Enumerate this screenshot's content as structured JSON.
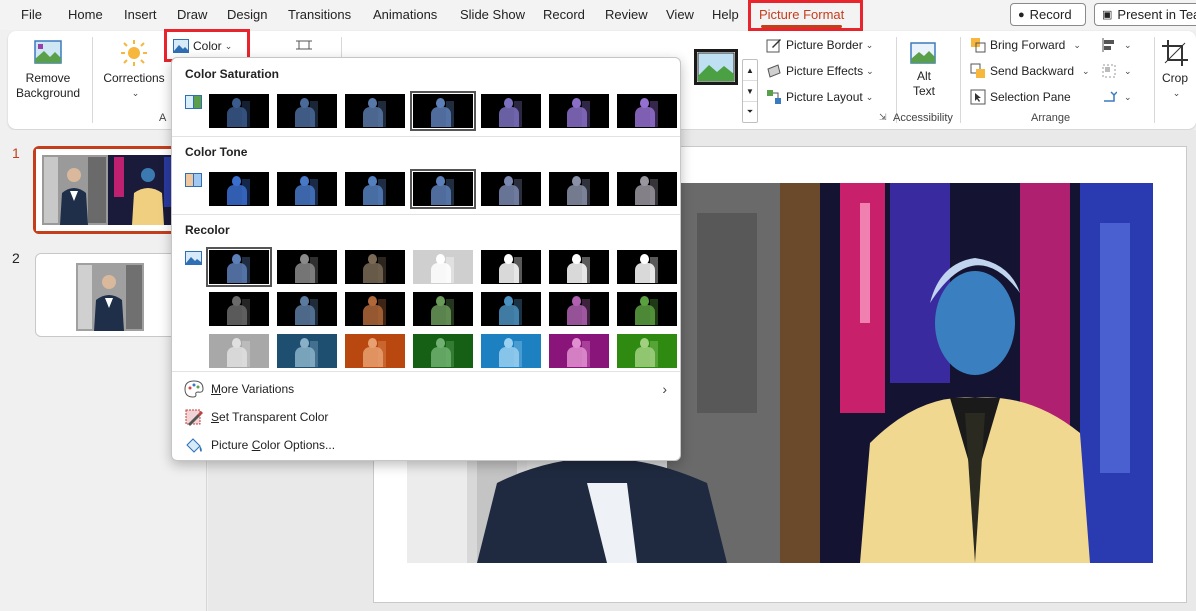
{
  "menu": {
    "tabs": [
      "File",
      "Home",
      "Insert",
      "Draw",
      "Design",
      "Transitions",
      "Animations",
      "Slide Show",
      "Record",
      "Review",
      "View",
      "Help",
      "Picture Format"
    ],
    "active_tab": "Picture Format",
    "record_button": "Record",
    "present_button": "Present in Tea"
  },
  "ribbon": {
    "remove_background": [
      "Remove",
      "Background"
    ],
    "corrections": "Corrections",
    "color": "Color",
    "adjust_group_fragment": "A",
    "picture_border": "Picture Border",
    "picture_effects": "Picture Effects",
    "picture_layout": "Picture Layout",
    "alt_text": [
      "Alt",
      "Text"
    ],
    "accessibility_group": "Accessibility",
    "bring_forward": "Bring Forward",
    "send_backward": "Send Backward",
    "selection_pane": "Selection Pane",
    "arrange_group": "Arrange",
    "crop": "Crop"
  },
  "slides": {
    "numbers": [
      "1",
      "2"
    ]
  },
  "dropdown": {
    "saturation_title": "Color Saturation",
    "tone_title": "Color Tone",
    "recolor_title": "Recolor",
    "more_variations": {
      "prefix": "",
      "accel": "M",
      "rest": "ore Variations"
    },
    "set_transparent": {
      "prefix": "",
      "accel": "S",
      "rest": "et Transparent Color"
    },
    "picture_color_options": {
      "prefix": "Picture ",
      "accel": "C",
      "rest": "olor Options..."
    },
    "saturation_colors": [
      "#3a5b8c",
      "#4a6a9a",
      "#5878a8",
      "#5d7fb8",
      "#7b70c0",
      "#8a6ec8",
      "#9470d0"
    ],
    "tone_colors": [
      "#3a6fd0",
      "#4878c8",
      "#5580c0",
      "#5d7fb8",
      "#7a88b0",
      "#8a90a8",
      "#9a96a0"
    ],
    "recolor_rows": [
      [
        {
          "bg": "#000000",
          "fig": "#5d7fb8"
        },
        {
          "bg": "#000000",
          "fig": "#8a8a8a"
        },
        {
          "bg": "#000000",
          "fig": "#7a6a55"
        },
        {
          "bg": "#cfcfcf",
          "fig": "#ffffff"
        },
        {
          "bg": "#000000",
          "fig": "#ffffff"
        },
        {
          "bg": "#000000",
          "fig": "#ffffff"
        },
        {
          "bg": "#000000",
          "fig": "#ffffff"
        }
      ],
      [
        {
          "bg": "#000000",
          "fig": "#6a6a6a"
        },
        {
          "bg": "#000000",
          "fig": "#5a7aa0"
        },
        {
          "bg": "#000000",
          "fig": "#b0673a"
        },
        {
          "bg": "#000000",
          "fig": "#6a9a5a"
        },
        {
          "bg": "#000000",
          "fig": "#4a90c0"
        },
        {
          "bg": "#000000",
          "fig": "#b060b0"
        },
        {
          "bg": "#000000",
          "fig": "#5aa040"
        }
      ],
      [
        {
          "bg": "#a8a8a8",
          "fig": "#e0e0e0"
        },
        {
          "bg": "#1f4f70",
          "fig": "#8ab0c8"
        },
        {
          "bg": "#b8480f",
          "fig": "#e8a070"
        },
        {
          "bg": "#156015",
          "fig": "#70b070"
        },
        {
          "bg": "#1d80c0",
          "fig": "#9ad0f0"
        },
        {
          "bg": "#8a157a",
          "fig": "#e090d0"
        },
        {
          "bg": "#2e8a10",
          "fig": "#a0d080"
        }
      ]
    ]
  },
  "colors": {
    "accent": "#c43e1c",
    "highlight": "#e8242c"
  }
}
